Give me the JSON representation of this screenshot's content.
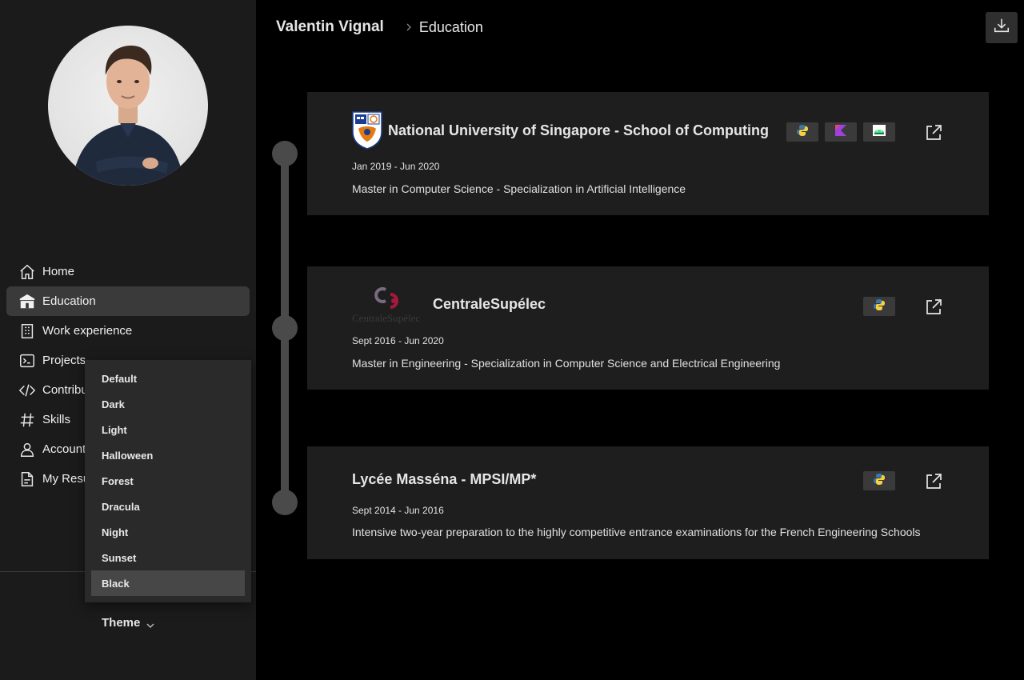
{
  "sidebar": {
    "nav": [
      {
        "label": "Home",
        "icon": "home-icon"
      },
      {
        "label": "Education",
        "icon": "school-icon",
        "active": true
      },
      {
        "label": "Work experience",
        "icon": "building-icon"
      },
      {
        "label": "Projects",
        "icon": "terminal-icon"
      },
      {
        "label": "Contributions",
        "icon": "code-icon"
      },
      {
        "label": "Skills",
        "icon": "hashtag-icon"
      },
      {
        "label": "Account",
        "icon": "person-icon"
      },
      {
        "label": "My Resume",
        "icon": "document-icon"
      }
    ],
    "theme_label": "Theme"
  },
  "theme_menu": {
    "options": [
      "Default",
      "Dark",
      "Light",
      "Halloween",
      "Forest",
      "Dracula",
      "Night",
      "Sunset",
      "Black"
    ],
    "selected": "Black"
  },
  "header": {
    "name": "Valentin Vignal",
    "separator": ">",
    "page": "Education"
  },
  "education": [
    {
      "title": "National University of Singapore - School of Computing",
      "dates": "Jan 2019 - Jun 2020",
      "description": "Master in Computer Science - Specialization in Artificial Intelligence",
      "technologies": [
        "python-icon",
        "kotlin-icon",
        "android-icon"
      ]
    },
    {
      "title": "CentraleSupélec",
      "logo_text": "CentraleSupélec",
      "dates": "Sept 2016 - Jun 2020",
      "description": "Master in Engineering - Specialization in Computer Science and Electrical Engineering",
      "technologies": [
        "python-icon"
      ]
    },
    {
      "title": "Lycée Masséna - MPSI/MP*",
      "dates": "Sept 2014 - Jun 2016",
      "description": "Intensive two-year preparation to the highly competitive entrance examinations for the French Engineering Schools",
      "technologies": [
        "python-icon"
      ]
    }
  ],
  "colors": {
    "background": "#000000",
    "sidebar": "#1b1b1b",
    "card": "#1e1e1e",
    "timeline": "#4a4a4a",
    "kotlin": "#a040e0",
    "android": "#3ddc84"
  }
}
